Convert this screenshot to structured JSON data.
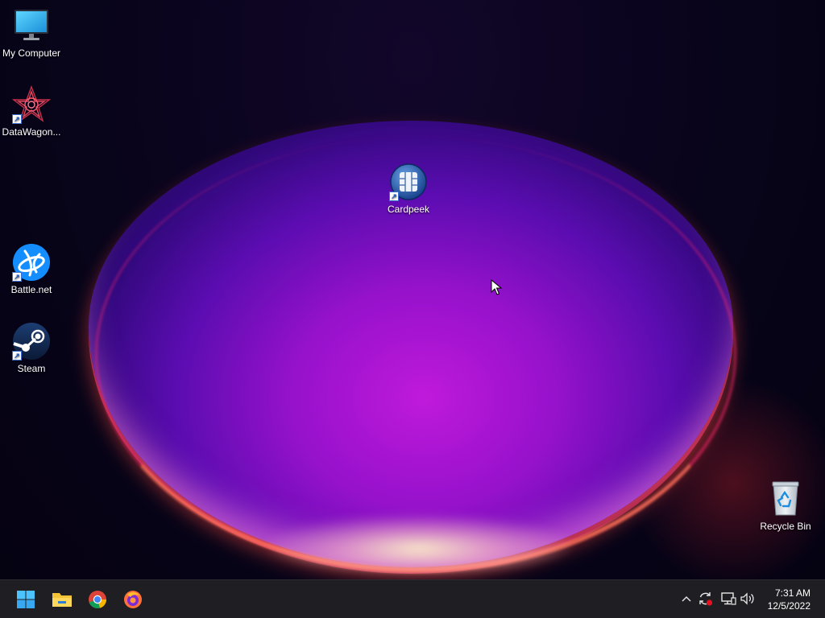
{
  "desktop": {
    "icons": [
      {
        "label": "My Computer",
        "icon": "monitor-icon",
        "shortcut": false
      },
      {
        "label": "DataWagon...",
        "icon": "datawagon-icon",
        "shortcut": true
      },
      {
        "label": "Cardpeek",
        "icon": "cardpeek-icon",
        "shortcut": true
      },
      {
        "label": "Battle.net",
        "icon": "battlenet-icon",
        "shortcut": true
      },
      {
        "label": "Steam",
        "icon": "steam-icon",
        "shortcut": true
      },
      {
        "label": "Recycle Bin",
        "icon": "recycle-bin-icon",
        "shortcut": false
      }
    ]
  },
  "taskbar": {
    "pinned": [
      {
        "name": "Start",
        "icon": "windows-start-icon"
      },
      {
        "name": "File Explorer",
        "icon": "folder-icon"
      },
      {
        "name": "Google Chrome",
        "icon": "chrome-icon"
      },
      {
        "name": "Firefox",
        "icon": "firefox-icon"
      }
    ],
    "tray": {
      "icons": [
        "chevron-up-icon",
        "update-icon",
        "network-icon",
        "volume-icon"
      ],
      "time": "7:31 AM",
      "date": "12/5/2022"
    }
  },
  "colors": {
    "taskbar_bg": "#1f1f23",
    "accent": "#0078d4"
  }
}
